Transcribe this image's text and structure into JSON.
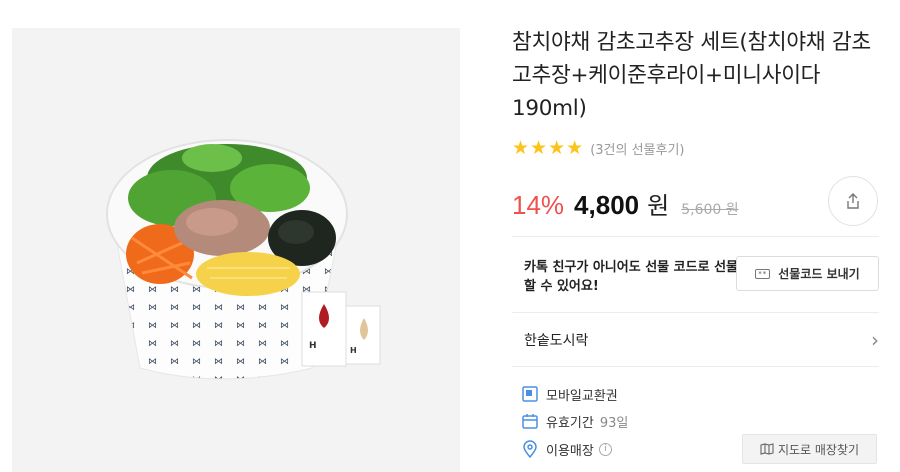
{
  "product": {
    "title": "참치야채 감초고추장 세트(참치야채 감초고추장+케이준후라이+미니사이다190ml)",
    "rating": {
      "stars": 4,
      "max_stars": 5,
      "review_text": "(3건의 선물후기)"
    },
    "price": {
      "discount": "14%",
      "amount": "4,800",
      "unit": "원",
      "original": "5,600 원"
    }
  },
  "gift": {
    "message": "카톡 친구가 아니어도 선물 코드로 선물 할 수 있어요!",
    "button_label": "선물코드 보내기",
    "button_icon_text": "**"
  },
  "brand": {
    "name": "한솥도시락"
  },
  "details": {
    "type": "모바일교환권",
    "validity_label": "유효기간",
    "validity_value": "93일",
    "store_label": "이용매장",
    "store_info_mark": "i",
    "map_button": "지도로 매장찾기"
  },
  "colors": {
    "discount": "#f0514f",
    "star": "#fcc41a",
    "icon_blue": "#4a90e2",
    "image_bg": "#f3f3f3"
  }
}
